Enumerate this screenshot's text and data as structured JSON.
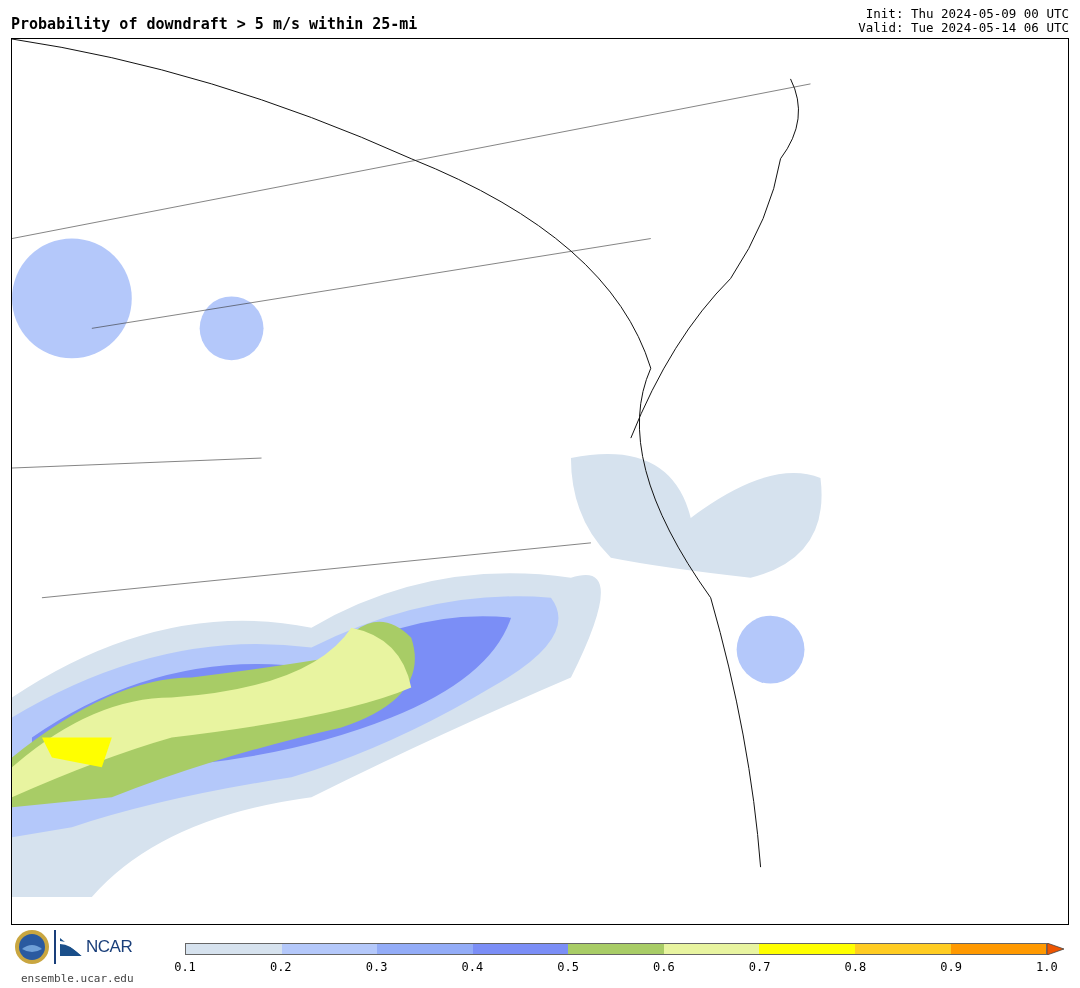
{
  "title": "Probability of downdraft > 5 m/s within 25-mi",
  "init": "Init: Thu 2024-05-09 00 UTC",
  "valid": "Valid: Tue 2024-05-14 06 UTC",
  "logos": {
    "org": "NCAR",
    "url": "ensemble.ucar.edu"
  },
  "colorbar": {
    "segments": [
      {
        "color": "#d6e2ee"
      },
      {
        "color": "#b4c8fa"
      },
      {
        "color": "#93acf7"
      },
      {
        "color": "#7b8ef6"
      },
      {
        "color": "#a8cc66"
      },
      {
        "color": "#e8f4a0"
      },
      {
        "color": "#ffff00"
      },
      {
        "color": "#ffcc22"
      },
      {
        "color": "#ff9900"
      }
    ],
    "extension": {
      "color": "#ee5500"
    },
    "ticks": [
      "0.1",
      "0.2",
      "0.3",
      "0.4",
      "0.5",
      "0.6",
      "0.7",
      "0.8",
      "0.9",
      "1.0"
    ]
  }
}
